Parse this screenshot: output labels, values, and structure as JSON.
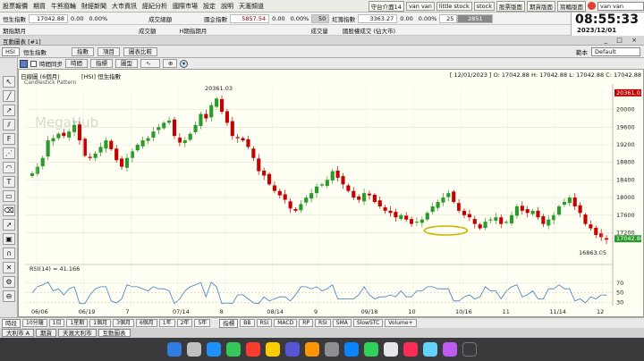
{
  "menubar": {
    "items": [
      "股票報價",
      "期貨",
      "牛熊窩輪",
      "財經新聞",
      "大市資訊",
      "經紀分析",
      "國際市場",
      "設定",
      "說明",
      "天滙頻道"
    ],
    "right": [
      "守台介面14",
      "van van",
      "little stock",
      "stock",
      "股票版面",
      "期貨版面",
      "窩輪版面"
    ],
    "search_value": "van van"
  },
  "quote_row1": {
    "label1": "恒生指數",
    "val1": "17042.88",
    "val2": "0.00",
    "val3": "0.00%",
    "label2": "成交總額",
    "label3": "國企指數",
    "val4": "5857.54",
    "val5": "0.00",
    "val6": "0.00%",
    "box1": "50",
    "label4": "紅籌指數",
    "val7": "3363.27",
    "val8": "0.00",
    "val9": "0.00%",
    "box2": "25",
    "box3": "2851"
  },
  "quote_row2": {
    "label1": "期指期月",
    "label2": "成交額",
    "label3": "H期指期月",
    "label4": "成交量",
    "label5": "國股權成交 (佔大市)"
  },
  "clock": {
    "time": "08:55:33",
    "date": "2023/12/01"
  },
  "window": {
    "title": "互動圖表 [#1]",
    "controls": "_ □ ×"
  },
  "toolbar": {
    "symbol": "HSI",
    "name": "恒生指數",
    "btn_index": "指數",
    "btn_item": "項目",
    "btn_compare": "圖表比較",
    "template_label": "範本",
    "template_value": "Default"
  },
  "toolbar2": {
    "checkbox_label": "時間同步",
    "btn_time": "時間",
    "btn_indicator": "指標",
    "btn_draw": "圖型"
  },
  "chart_header": {
    "left": "日線圖 (6個月)",
    "mid": "[HSI] 恒生指數",
    "right": "[ 12/01/2023 ] O: 17042.88 H: 17042.88 L: 17042.88 C: 17042.88",
    "pattern": "Candlestick Pattern",
    "watermark": "MegaHub"
  },
  "chart_data": {
    "type": "candlestick",
    "title": "[HSI] 恒生指數",
    "y_ticks": [
      17200,
      17600,
      18000,
      18400,
      18800,
      19200,
      19600,
      20000
    ],
    "y_range": [
      16600,
      20500
    ],
    "x_ticks": [
      "06/06",
      "06/19",
      "7",
      "07/14",
      "8",
      "08/14",
      "9",
      "09/18",
      "10",
      "10/16",
      "11",
      "11/14",
      "12"
    ],
    "annotations": {
      "high": "20361.03",
      "low": "16863.05",
      "last": "17042.88",
      "top_label": "20361.03"
    },
    "closes": [
      18550,
      18700,
      18900,
      19300,
      19350,
      19450,
      19400,
      19500,
      19650,
      19300,
      18950,
      18900,
      19000,
      19150,
      19300,
      19100,
      18850,
      18700,
      18900,
      19050,
      19200,
      19300,
      19350,
      19500,
      19600,
      19700,
      19750,
      19400,
      19250,
      19300,
      19450,
      19650,
      19900,
      19800,
      20100,
      20250,
      19950,
      19700,
      19400,
      19350,
      19300,
      19150,
      18900,
      18600,
      18500,
      18300,
      18150,
      18050,
      17950,
      17750,
      17700,
      17850,
      18000,
      18100,
      18250,
      18300,
      18400,
      18600,
      18450,
      18300,
      18150,
      18000,
      17950,
      18100,
      18050,
      17900,
      17800,
      17700,
      17650,
      17550,
      17600,
      17500,
      17400,
      17450,
      17500,
      17650,
      17800,
      17900,
      18000,
      18100,
      17900,
      17700,
      17600,
      17550,
      17400,
      17300,
      17450,
      17500,
      17550,
      17400,
      17450,
      17600,
      17800,
      17700,
      17650,
      17700,
      17550,
      17400,
      17500,
      17600,
      17800,
      17900,
      18000,
      17800,
      17650,
      17400,
      17300,
      17150,
      17100,
      17042.88
    ]
  },
  "rsi": {
    "label": "RSI(14) = 41.166",
    "ticks": [
      "70",
      "50",
      "30"
    ]
  },
  "bottombar": {
    "period": "時段",
    "periods": [
      "10分鐘",
      "1日",
      "1星期",
      "1個月",
      "3個月",
      "6個月",
      "1年",
      "2年",
      "5年"
    ],
    "indicators_label": "指標",
    "indicators": [
      "BB",
      "RSI",
      "MACD",
      "RP",
      "RSI",
      "SMA",
      "SlowSTC",
      "Volume+"
    ]
  },
  "wintabs": [
    "大利市 A",
    "期貨",
    "天滙大利市",
    "互動圖表"
  ]
}
